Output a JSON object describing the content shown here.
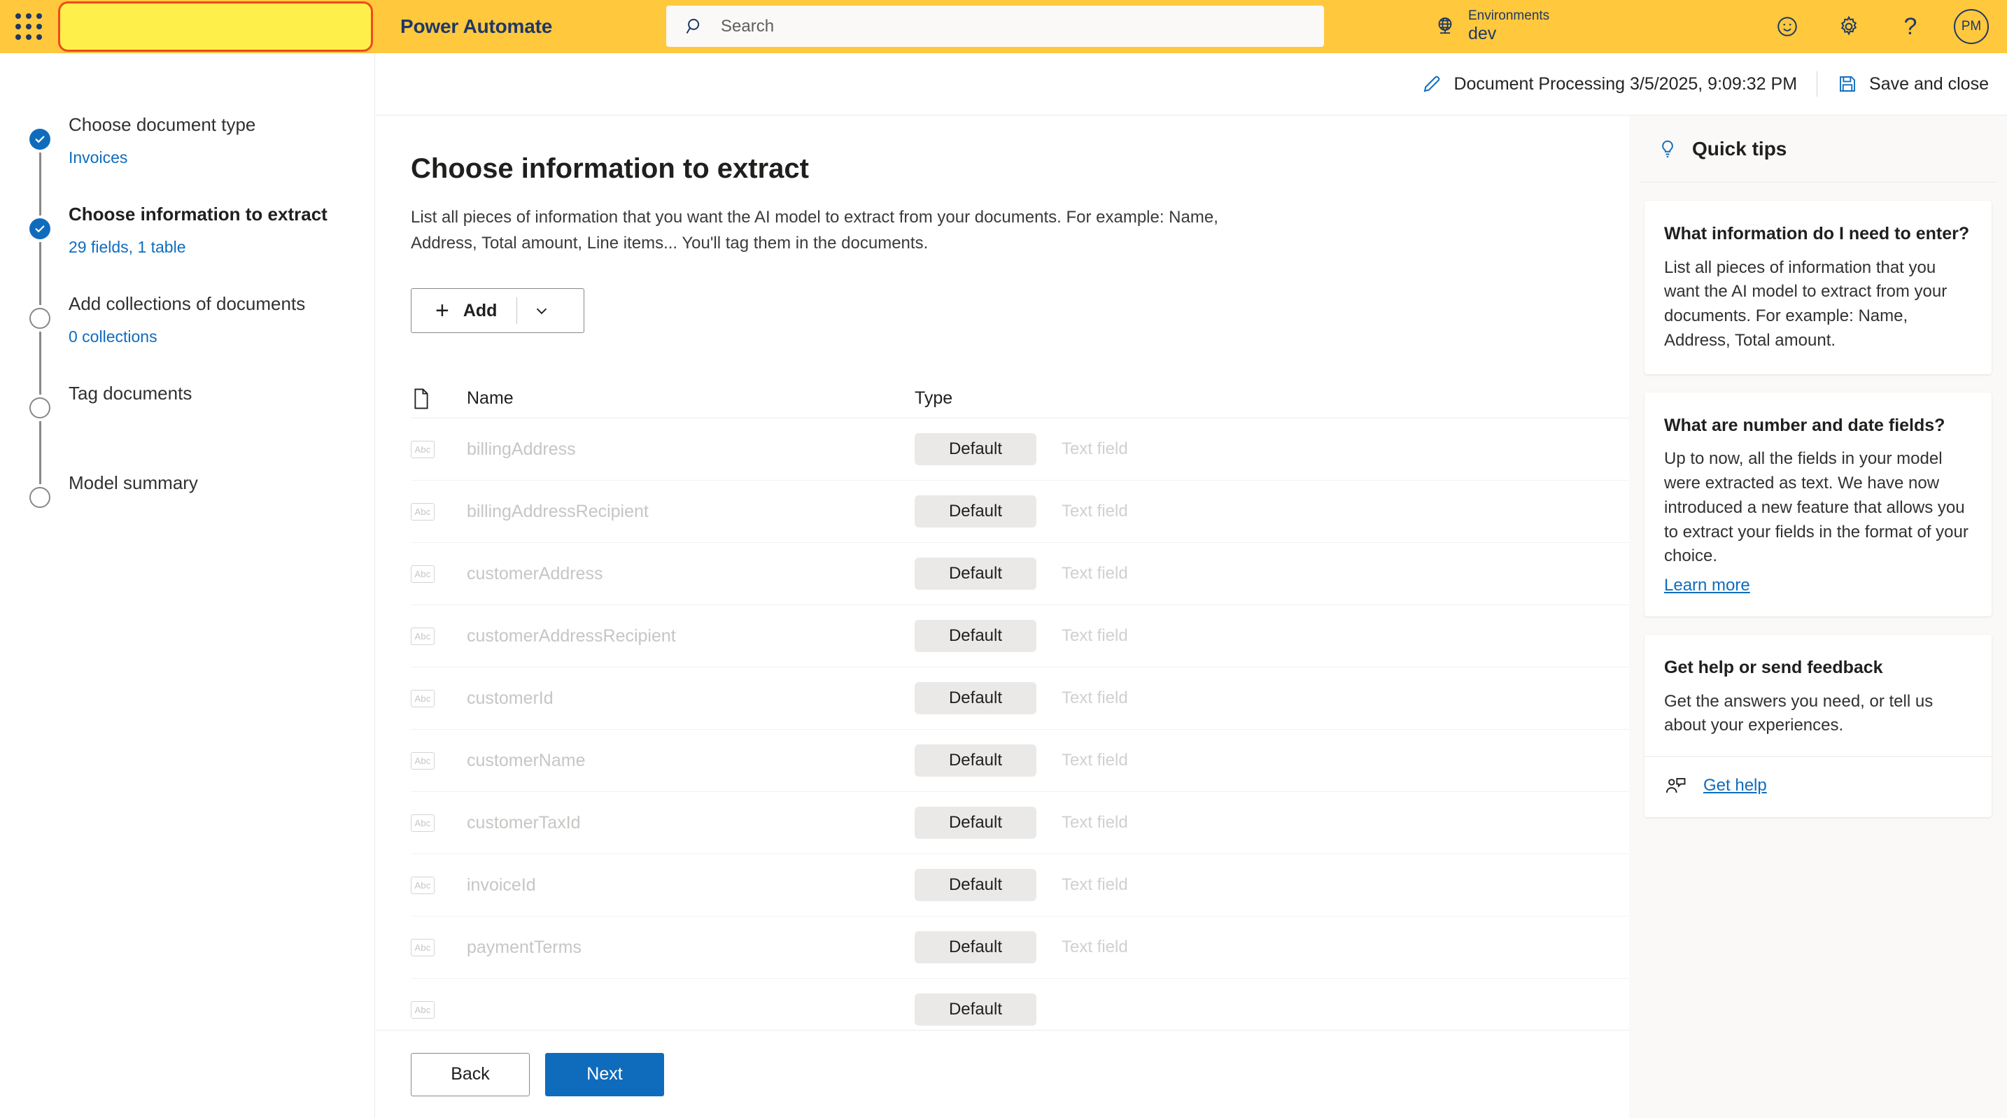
{
  "suitebar": {
    "waffle_label": "App launcher",
    "app_title": "Power Automate",
    "search_placeholder": "Search",
    "environments_label": "Environments",
    "environment_value": "dev",
    "avatar_initials": "PM",
    "icons": {
      "waffle": "waffle-icon",
      "search": "search-icon",
      "environment": "globe-icon",
      "feedback": "smiley-icon",
      "settings": "gear-icon",
      "help": "question-mark-icon"
    },
    "help_glyph": "?",
    "accent_bg": "#ffc83d",
    "accent_text": "#1f3864",
    "highlight_fill": "#ffef4a",
    "highlight_border": "#f04a1d"
  },
  "commandbar": {
    "model_name": "Document Processing 3/5/2025, 9:09:32 PM",
    "save_label": "Save and close",
    "edit_icon": "pencil-icon",
    "save_icon": "save-icon",
    "icon_color": "#0f6cbd"
  },
  "wizard": {
    "steps": [
      {
        "title": "Choose document type",
        "sub": "Invoices",
        "state": "done"
      },
      {
        "title": "Choose information to extract",
        "sub": "29 fields, 1 table",
        "state": "current"
      },
      {
        "title": "Add collections of documents",
        "sub": "0 collections",
        "state": "todo"
      },
      {
        "title": "Tag documents",
        "sub": "",
        "state": "todo"
      },
      {
        "title": "Model summary",
        "sub": "",
        "state": "todo"
      }
    ]
  },
  "main": {
    "title": "Choose information to extract",
    "description": "List all pieces of information that you want the AI model to extract from your documents. For example: Name, Address, Total amount, Line items... You'll tag them in the documents.",
    "add_button": {
      "plus": "+",
      "label": "Add",
      "caret_icon": "chevron-down-icon"
    },
    "table": {
      "header_icon": "document-icon",
      "columns": [
        "Name",
        "Type"
      ],
      "rows": [
        {
          "icon": "abc-icon",
          "icon_text": "Abc",
          "name": "billingAddress",
          "format": "Default",
          "type": "Text field"
        },
        {
          "icon": "abc-icon",
          "icon_text": "Abc",
          "name": "billingAddressRecipient",
          "format": "Default",
          "type": "Text field"
        },
        {
          "icon": "abc-icon",
          "icon_text": "Abc",
          "name": "customerAddress",
          "format": "Default",
          "type": "Text field"
        },
        {
          "icon": "abc-icon",
          "icon_text": "Abc",
          "name": "customerAddressRecipient",
          "format": "Default",
          "type": "Text field"
        },
        {
          "icon": "abc-icon",
          "icon_text": "Abc",
          "name": "customerId",
          "format": "Default",
          "type": "Text field"
        },
        {
          "icon": "abc-icon",
          "icon_text": "Abc",
          "name": "customerName",
          "format": "Default",
          "type": "Text field"
        },
        {
          "icon": "abc-icon",
          "icon_text": "Abc",
          "name": "customerTaxId",
          "format": "Default",
          "type": "Text field"
        },
        {
          "icon": "abc-icon",
          "icon_text": "Abc",
          "name": "invoiceId",
          "format": "Default",
          "type": "Text field"
        },
        {
          "icon": "abc-icon",
          "icon_text": "Abc",
          "name": "paymentTerms",
          "format": "Default",
          "type": "Text field"
        },
        {
          "icon": "abc-icon",
          "icon_text": "Abc",
          "name": "",
          "format": "Default",
          "type": ""
        }
      ]
    },
    "footer": {
      "back_label": "Back",
      "next_label": "Next",
      "primary_color": "#0f6cbd"
    }
  },
  "tips": {
    "panel_title": "Quick tips",
    "bulb_icon": "lightbulb-icon",
    "cards": [
      {
        "title": "What information do I need to enter?",
        "body": "List all pieces of information that you want the AI model to extract from your documents. For example: Name, Address, Total amount.",
        "link": ""
      },
      {
        "title": "What are number and date fields?",
        "body": "Up to now, all the fields in your model were extracted as text. We have now introduced a new feature that allows you to extract your fields in the format of your choice.",
        "link": "Learn more"
      },
      {
        "title": "Get help or send feedback",
        "body": "Get the answers you need, or tell us about your experiences.",
        "action_label": "Get help",
        "action_icon": "person-feedback-icon"
      }
    ]
  }
}
